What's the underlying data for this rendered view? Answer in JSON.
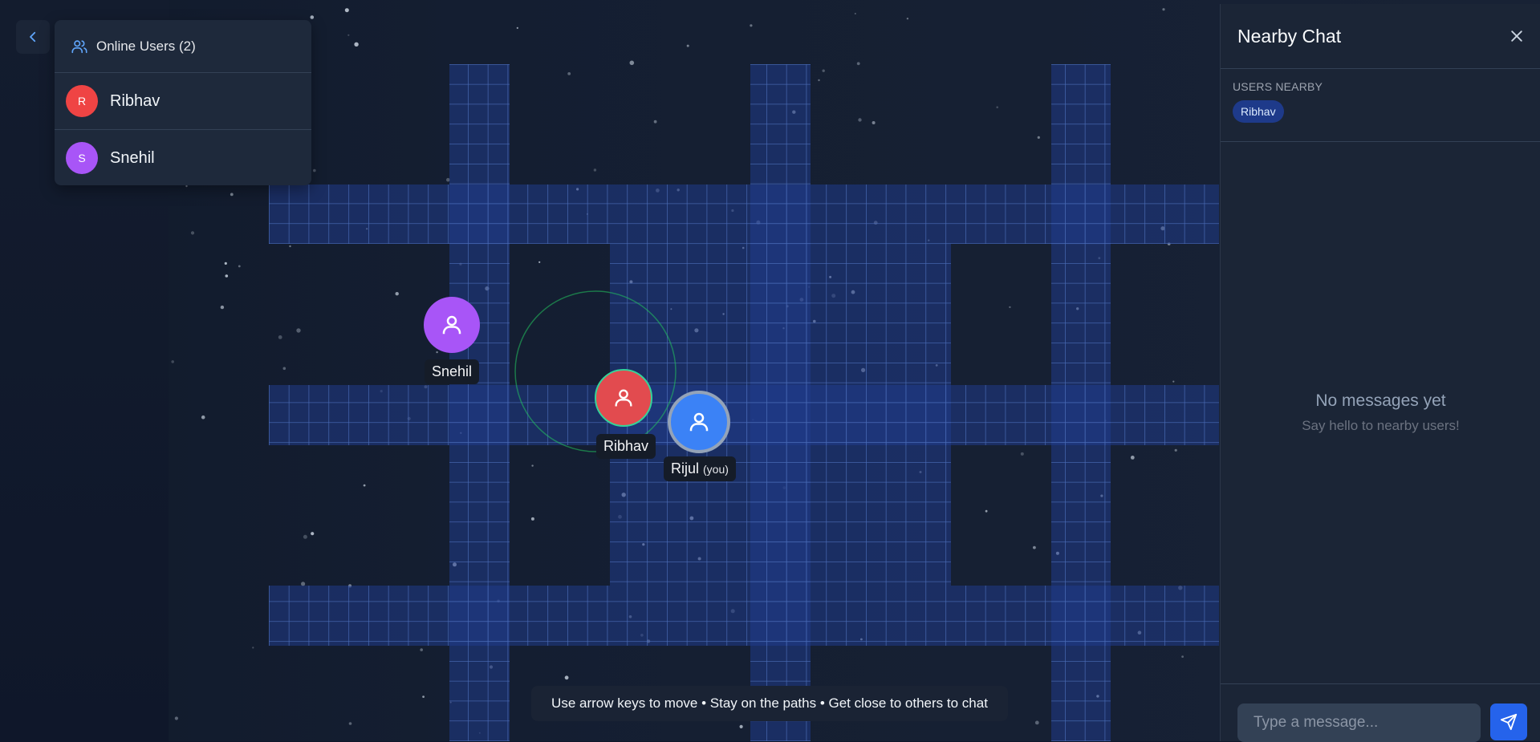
{
  "colors": {
    "background": "#0f172a",
    "path": "#1e3a8a",
    "path_grid": "#4b6db8",
    "panel": "#1e293b",
    "accent": "#2563eb",
    "proximity_ring": "#22c55e"
  },
  "sidebar": {
    "back_icon": "chevron-left-icon",
    "header_icon": "users-icon",
    "header": "Online Users (2)",
    "users": [
      {
        "initial": "R",
        "name": "Ribhav",
        "color": "#ef4444"
      },
      {
        "initial": "S",
        "name": "Snehil",
        "color": "#a855f7"
      }
    ]
  },
  "map": {
    "players": [
      {
        "name": "Snehil",
        "color": "#a855f7",
        "icon": "user-icon"
      },
      {
        "name": "Ribhav",
        "color": "#e24b4f",
        "icon": "user-icon",
        "ring": "#34d399"
      },
      {
        "name": "Rijul",
        "suffix": "(you)",
        "color": "#3b82f6",
        "icon": "user-icon",
        "ring": "#94a3b8"
      }
    ]
  },
  "hint": "Use arrow keys to move • Stay on the paths • Get close to others to chat",
  "chat": {
    "title": "Nearby Chat",
    "close_icon": "close-icon",
    "nearby_label": "USERS NEARBY",
    "nearby_users": [
      "Ribhav"
    ],
    "empty_title": "No messages yet",
    "empty_subtitle": "Say hello to nearby users!",
    "input_placeholder": "Type a message...",
    "send_icon": "send-icon"
  }
}
